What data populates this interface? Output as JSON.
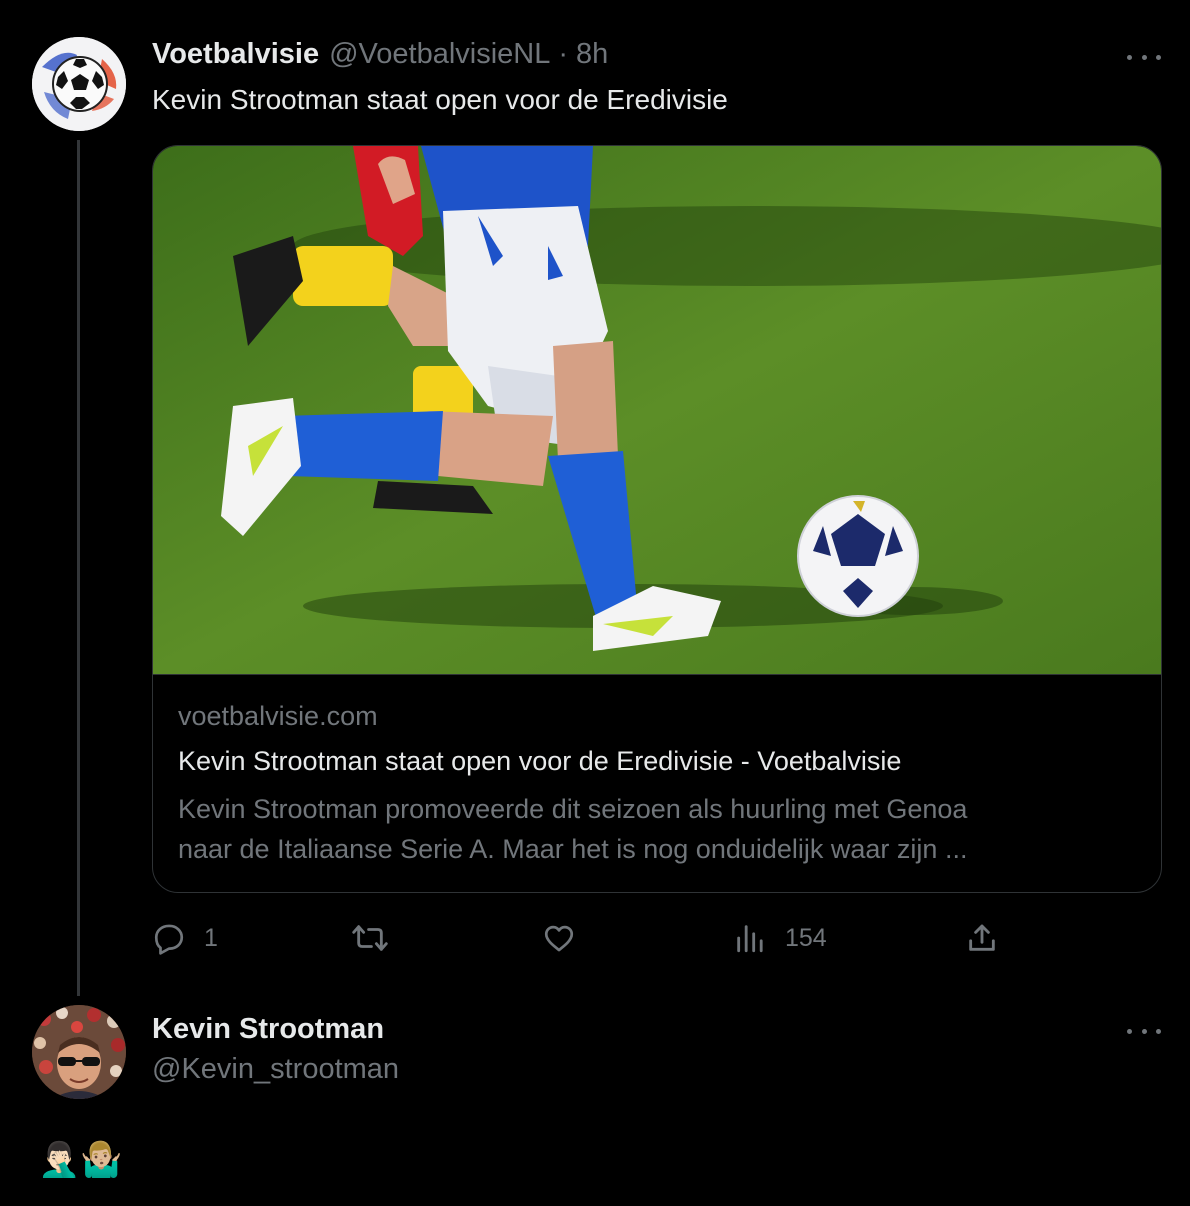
{
  "tweet": {
    "display_name": "Voetbalvisie",
    "handle": "@VoetbalvisieNL",
    "separator": "·",
    "time": "8h",
    "text": "Kevin Strootman staat open voor de Eredivisie",
    "card": {
      "domain": "voetbalvisie.com",
      "title": "Kevin Strootman staat open voor de Eredivisie - Voetbalvisie",
      "description_line1": "Kevin Strootman promoveerde dit seizoen als huurling met Genoa",
      "description_line2": "naar de Italiaanse Serie A. Maar het is nog onduidelijk waar zijn ..."
    },
    "actions": {
      "reply_icon": "reply-icon",
      "reply_count": "1",
      "retweet_icon": "retweet-icon",
      "like_icon": "like-icon",
      "views_icon": "views-icon",
      "views_count": "154",
      "share_icon": "share-icon"
    }
  },
  "reply": {
    "display_name": "Kevin Strootman",
    "handle": "@Kevin_strootman",
    "text": "🤦🏻‍♂️🤷🏼‍♂️"
  },
  "colors": {
    "background": "#000000",
    "text_primary": "#e7e9ea",
    "text_muted": "#71767b",
    "border": "#2f3336"
  }
}
